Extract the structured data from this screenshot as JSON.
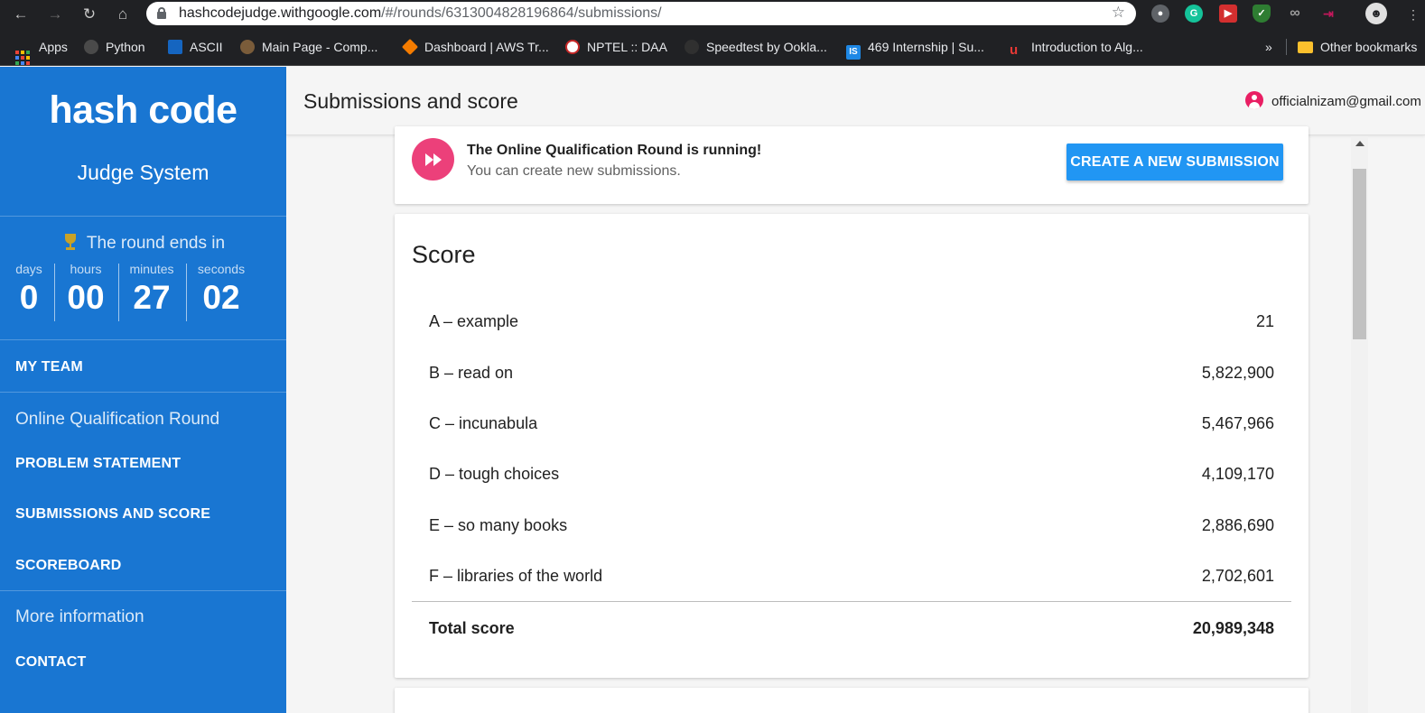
{
  "browser": {
    "url_host": "hashcodejudge.withgoogle.com",
    "url_path": "/#/rounds/6313004828196864/submissions/",
    "bookmarks": [
      {
        "label": "Apps",
        "icon": "apps-grid-icon"
      },
      {
        "label": "Python",
        "icon": "python-icon",
        "color": "#4a4a4a"
      },
      {
        "label": "ASCII",
        "icon": "ascii-icon",
        "color": "#1565c0"
      },
      {
        "label": "Main Page - Comp...",
        "icon": "main-page-icon",
        "color": "#7a5c3a"
      },
      {
        "label": "Dashboard | AWS Tr...",
        "icon": "aws-icon",
        "color": "#f57c00"
      },
      {
        "label": "NPTEL :: DAA",
        "icon": "nptel-icon",
        "color": "#c62828"
      },
      {
        "label": "Speedtest by Ookla...",
        "icon": "speedtest-icon",
        "color": "#303030"
      },
      {
        "label": "469 Internship | Su...",
        "icon": "internshala-icon",
        "color": "#1e88e5"
      },
      {
        "label": "Introduction to Alg...",
        "icon": "udemy-icon",
        "color": "#e53935"
      }
    ],
    "more_bookmarks": "»",
    "other_bookmarks": "Other bookmarks"
  },
  "sidebar": {
    "logo": "hash code",
    "subtitle": "Judge System",
    "round_ends": "The round ends in",
    "countdown": [
      {
        "unit": "days",
        "value": "0"
      },
      {
        "unit": "hours",
        "value": "00"
      },
      {
        "unit": "minutes",
        "value": "27"
      },
      {
        "unit": "seconds",
        "value": "02"
      }
    ],
    "my_team": "MY TEAM",
    "round_section": "Online Qualification Round",
    "problem_statement": "PROBLEM STATEMENT",
    "submissions": "SUBMISSIONS AND SCORE",
    "scoreboard": "SCOREBOARD",
    "more_info": "More information",
    "contact": "CONTACT"
  },
  "header": {
    "title": "Submissions and score",
    "user_email": "officialnizam@gmail.com"
  },
  "banner": {
    "title": "The Online Qualification Round is running!",
    "subtitle": "You can create new submissions.",
    "button": "CREATE A NEW SUBMISSION"
  },
  "score": {
    "title": "Score",
    "rows": [
      {
        "label": "A – example",
        "value": "21"
      },
      {
        "label": "B – read on",
        "value": "5,822,900"
      },
      {
        "label": "C – incunabula",
        "value": "5,467,966"
      },
      {
        "label": "D – tough choices",
        "value": "4,109,170"
      },
      {
        "label": "E – so many books",
        "value": "2,886,690"
      },
      {
        "label": "F – libraries of the world",
        "value": "2,702,601"
      }
    ],
    "total_label": "Total score",
    "total_value": "20,989,348"
  },
  "colors": {
    "sidebar": "#1976d2",
    "accent_button": "#2196f3",
    "banner_icon": "#ec407a",
    "avatar": "#e91e63",
    "browser_chrome": "#202124"
  }
}
